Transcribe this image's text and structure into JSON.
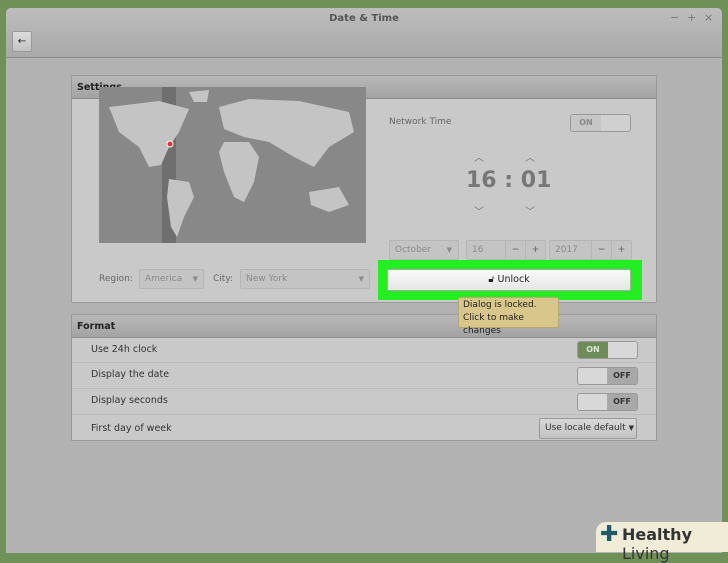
{
  "window": {
    "title": "Date & Time",
    "controls": [
      "−",
      "+",
      "×"
    ],
    "back_icon": "←"
  },
  "settings": {
    "title": "Settings",
    "region_label": "Region:",
    "region_value": "America",
    "city_label": "City:",
    "city_value": "New York",
    "network_time_label": "Network Time",
    "network_time_state": "ON",
    "hour": "16",
    "separator": ":",
    "minute": "01",
    "month": "October",
    "day": "16",
    "year": "2017",
    "minus": "−",
    "plus": "+",
    "unlock_label": "Unlock",
    "tooltip_line1": "Dialog is locked.",
    "tooltip_line2": "Click to make changes"
  },
  "format": {
    "title": "Format",
    "rows": [
      {
        "label": "Use 24h clock",
        "state": "ON"
      },
      {
        "label": "Display the date",
        "state": "OFF"
      },
      {
        "label": "Display seconds",
        "state": "OFF"
      },
      {
        "label": "First day of week",
        "value": "Use locale default"
      }
    ]
  },
  "watermark": {
    "brand": "Healthy",
    "brand2": "Living"
  },
  "colors": {
    "background": "#6f9157",
    "highlight": "#22ee22",
    "toggle_on": "#6e8c5a"
  }
}
